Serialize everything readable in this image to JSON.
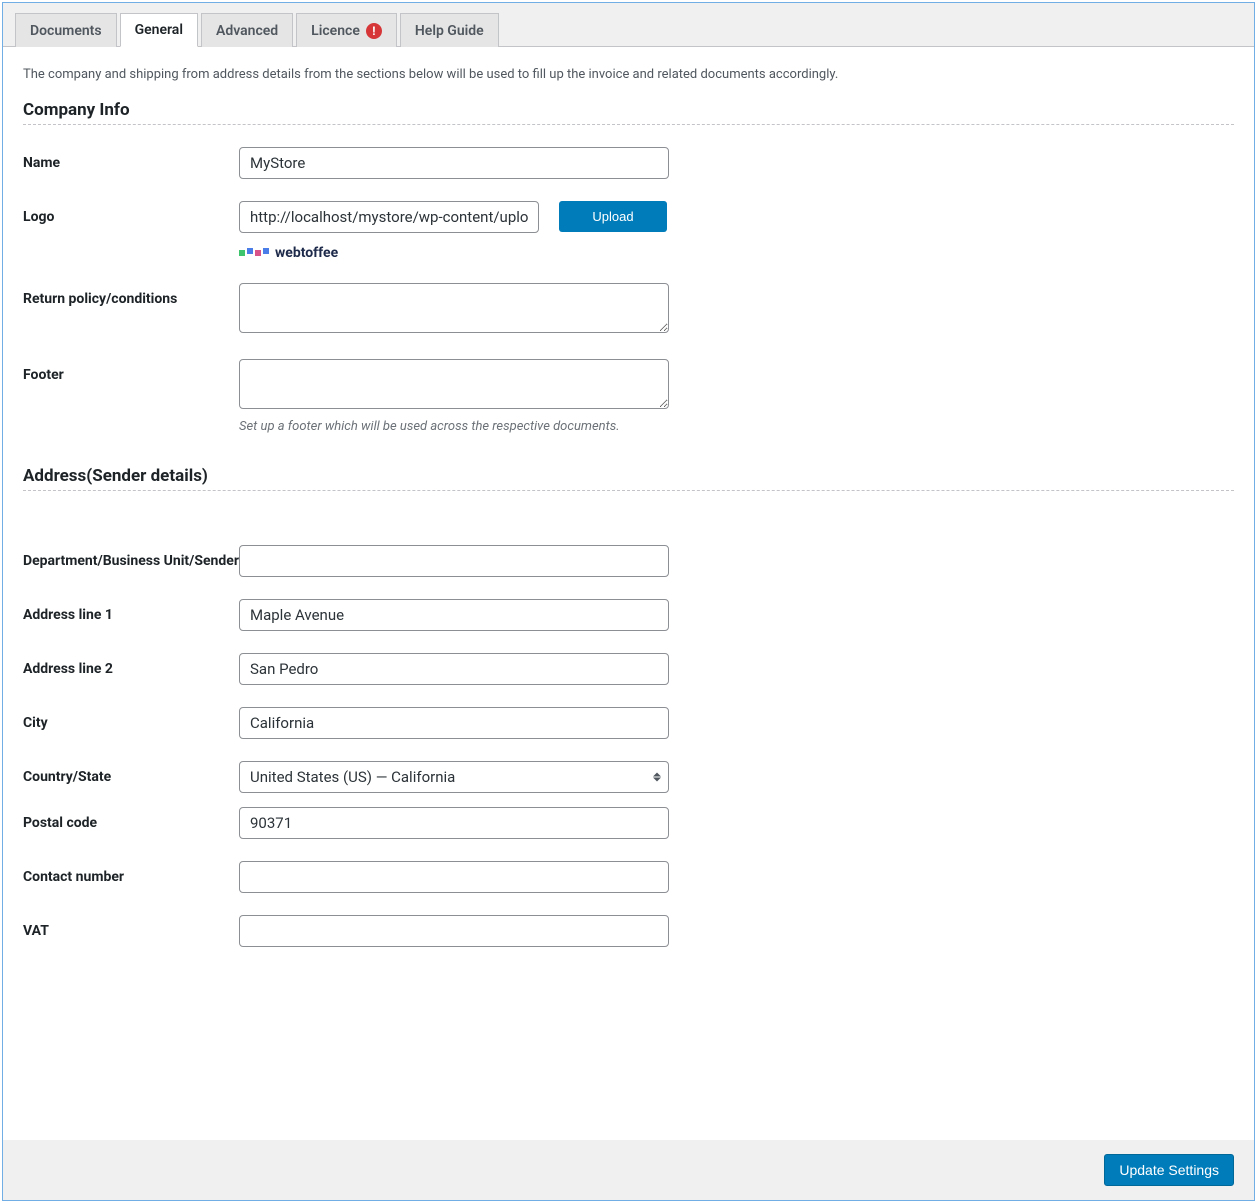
{
  "tabs": [
    {
      "label": "Documents"
    },
    {
      "label": "General"
    },
    {
      "label": "Advanced"
    },
    {
      "label": "Licence",
      "badge": "!"
    },
    {
      "label": "Help Guide"
    }
  ],
  "intro": "The company and shipping from address details from the sections below will be used to fill up the invoice and related documents accordingly.",
  "sections": {
    "company": {
      "title": "Company Info",
      "name": {
        "label": "Name",
        "value": "MyStore"
      },
      "logo": {
        "label": "Logo",
        "value": "http://localhost/mystore/wp-content/upload",
        "upload_label": "Upload",
        "preview_text": "webtoffee"
      },
      "return_policy": {
        "label": "Return policy/conditions",
        "value": ""
      },
      "footer": {
        "label": "Footer",
        "value": "",
        "help": "Set up a footer which will be used across the respective documents."
      }
    },
    "address": {
      "title": "Address(Sender details)",
      "department": {
        "label": "Department/Business Unit/Sender",
        "value": ""
      },
      "addr1": {
        "label": "Address line 1",
        "value": "Maple Avenue"
      },
      "addr2": {
        "label": "Address line 2",
        "value": "San Pedro"
      },
      "city": {
        "label": "City",
        "value": "California"
      },
      "country": {
        "label": "Country/State",
        "value": "United States (US) — California"
      },
      "postal": {
        "label": "Postal code",
        "value": "90371"
      },
      "contact": {
        "label": "Contact number",
        "value": ""
      },
      "vat": {
        "label": "VAT",
        "value": ""
      }
    }
  },
  "update_button": "Update Settings"
}
